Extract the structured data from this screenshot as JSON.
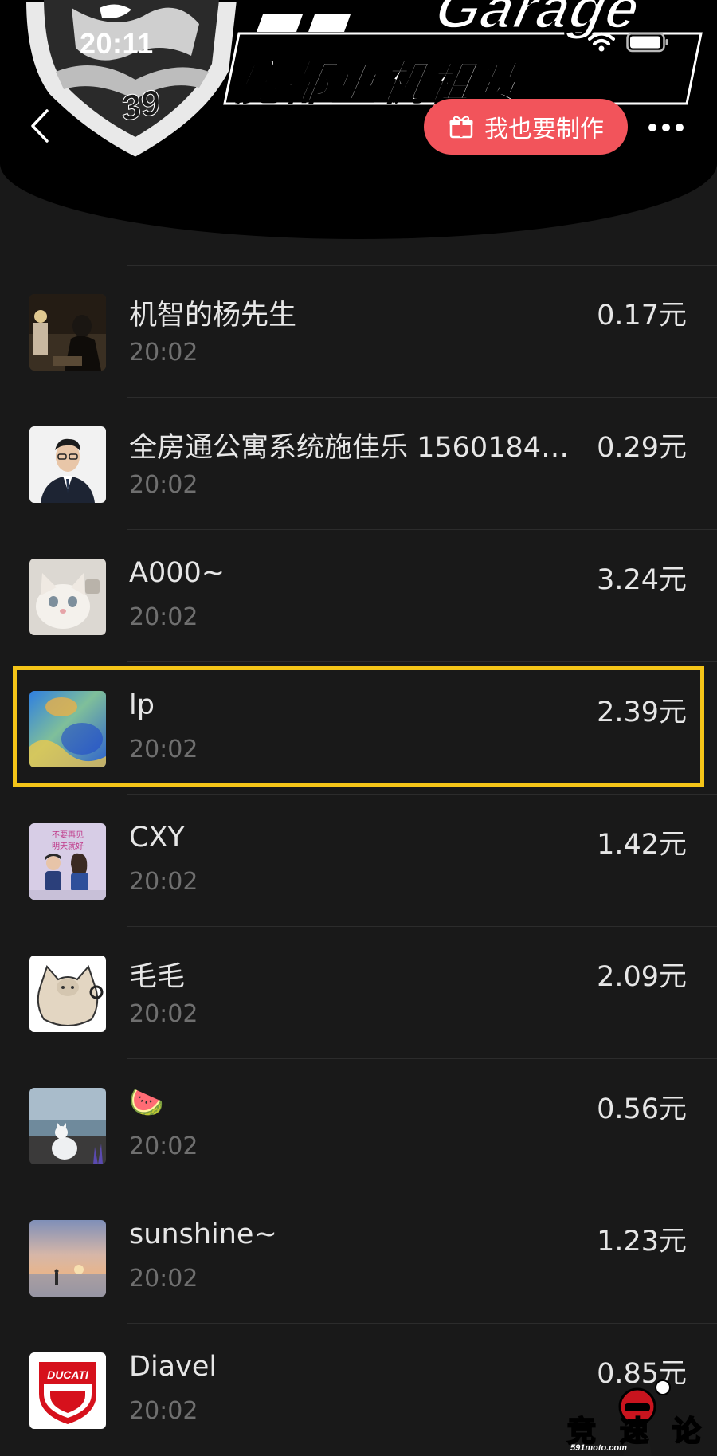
{
  "status_bar": {
    "time": "20:11"
  },
  "banner": {
    "title": "Garage",
    "subtitle": "魔都重机租赁",
    "badge_number": "39"
  },
  "header": {
    "make_button_label": "我也要制作"
  },
  "rows": [
    {
      "name": "机智的杨先生",
      "time": "20:02",
      "amount": "0.17元"
    },
    {
      "name": "全房通公寓系统施佳乐 15601843...",
      "time": "20:02",
      "amount": "0.29元"
    },
    {
      "name": "A000~",
      "time": "20:02",
      "amount": "3.24元"
    },
    {
      "name": "lp",
      "time": "20:02",
      "amount": "2.39元"
    },
    {
      "name": "CXY",
      "time": "20:02",
      "amount": "1.42元"
    },
    {
      "name": "毛毛",
      "time": "20:02",
      "amount": "2.09元"
    },
    {
      "name": "🍉",
      "time": "20:02",
      "amount": "0.56元"
    },
    {
      "name": "sunshine~",
      "time": "20:02",
      "amount": "1.23元"
    },
    {
      "name": "Diavel",
      "time": "20:02",
      "amount": "0.85元"
    }
  ],
  "avatar_labels": {
    "cxy_line1": "不要再见",
    "cxy_line2": "明天就好",
    "ducati": "DUCATI"
  },
  "watermark": {
    "text": "竞速论坛",
    "site": "591moto.com"
  },
  "colors": {
    "background": "#191919",
    "accent_button": "#f2545b",
    "highlight_border": "#f5c518",
    "primary_text": "#e6e6e6",
    "secondary_text": "#6f6f6f"
  }
}
